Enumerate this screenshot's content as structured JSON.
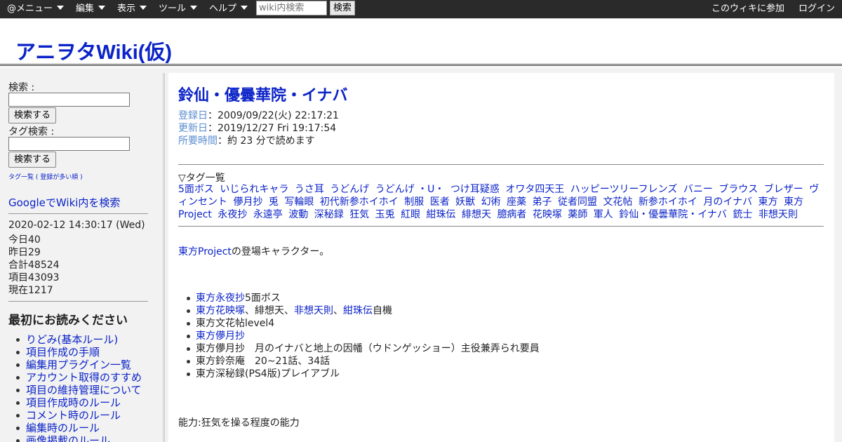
{
  "toolbar": {
    "menus": [
      "@メニュー",
      "編集",
      "表示",
      "ツール",
      "ヘルプ"
    ],
    "search_placeholder": "wiki内検索",
    "search_button": "検索",
    "join_link": "このウィキに参加",
    "login_link": "ログイン"
  },
  "header": {
    "site_title": "アニヲタWiki(仮)"
  },
  "sidebar": {
    "search_label": "検索 :",
    "search_button": "検索する",
    "tag_search_label": "タグ検索 :",
    "tag_search_button": "検索する",
    "tag_list_links": [
      "タグ一覧",
      "登録が多い順"
    ],
    "google_search_link": "GoogleでWiki内を検索",
    "stats": {
      "datetime": "2020-02-12 14:30:17 (Wed)",
      "today": "今日40",
      "yesterday": "昨日29",
      "total": "合計48524",
      "items": "項目43093",
      "current": "現在1217"
    },
    "read_first_heading": "最初にお読みください",
    "read_first_items": [
      "りどみ(基本ルール)",
      "項目作成の手順",
      "編集用プラグイン一覧",
      "アカウント取得のすすめ",
      "項目の維持管理について",
      "項目作成時のルール",
      "コメント時のルール",
      "編集時のルール",
      "画像掲載のルール"
    ]
  },
  "main": {
    "title": "鈴仙・優曇華院・イナバ",
    "registered_label": "登録日",
    "registered_value": "2009/09/22(火) 22:17:21",
    "updated_label": "更新日",
    "updated_value": "2019/12/27 Fri 19:17:54",
    "reading_label": "所要時間",
    "reading_value": "約 23 分で読めます",
    "tag_heading": "▽タグ一覧",
    "tags": [
      "5面ボス",
      "いじられキャラ",
      "うさ耳",
      "うどんげ",
      "うどんげ ・U・",
      "つけ耳疑惑",
      "オワタ四天王",
      "ハッピーツリーフレンズ",
      "バニー",
      "ブラウス",
      "ブレザー",
      "ヴィンセント",
      "儚月抄",
      "兎",
      "写輪眼",
      "初代新参ホイホイ",
      "制服",
      "医者",
      "妖獣",
      "幻術",
      "座薬",
      "弟子",
      "従者同盟",
      "文花帖",
      "新参ホイホイ",
      "月のイナバ",
      "東方",
      "東方Project",
      "永夜抄",
      "永遠亭",
      "波動",
      "深秘録",
      "狂気",
      "玉兎",
      "紅眼",
      "紺珠伝",
      "緋想天",
      "臆病者",
      "花映塚",
      "薬師",
      "軍人",
      "鈴仙・優曇華院・イナバ",
      "銃士",
      "非想天則"
    ],
    "intro_link": "東方Project",
    "intro_text": "の登場キャラクター。",
    "appearances": [
      {
        "link": "東方永夜抄",
        "rest": "5面ボス"
      },
      {
        "link": "東方花映塚",
        "rest": "、緋想天、",
        "link2": "非想天則",
        "sep2": "、",
        "link3": "紺珠伝",
        "rest3": "自機"
      },
      {
        "text": "東方文花帖level4"
      },
      {
        "link": "東方儚月抄",
        "rest": ""
      },
      {
        "text": "東方儚月抄　月のイナバと地上の因幡（ウドンゲッショー）主役兼弄られ要員"
      },
      {
        "text": "東方鈴奈庵　20~21話、34話"
      },
      {
        "text": "東方深秘録(PS4版)プレイアブル"
      }
    ],
    "ability": "能力:狂気を操る程度の能力"
  }
}
